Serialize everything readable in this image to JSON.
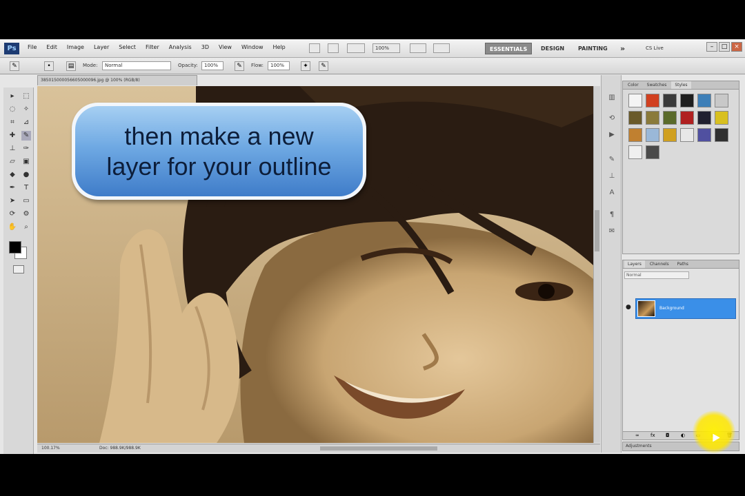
{
  "menubar": {
    "logo": "Ps",
    "items": [
      "File",
      "Edit",
      "Image",
      "Layer",
      "Select",
      "Filter",
      "Analysis",
      "3D",
      "View",
      "Window",
      "Help"
    ],
    "zoom": "100%",
    "workspaces": [
      "ESSENTIALS",
      "DESIGN",
      "PAINTING"
    ],
    "more": "»",
    "cs_live": "CS Live"
  },
  "options": {
    "mode_label": "Mode:",
    "mode_value": "Normal",
    "opacity_label": "Opacity:",
    "opacity_value": "100%",
    "flow_label": "Flow:",
    "flow_value": "100%"
  },
  "document": {
    "tab_title": "385015000056605000096.jpg @ 100% (RGB/8)",
    "zoom_status": "100.17%",
    "doc_info": "Doc: 988.9K/988.9K"
  },
  "callout": {
    "line1": "then make a new",
    "line2": "layer for your outline"
  },
  "styles_panel": {
    "tabs": [
      "Color",
      "Swatches",
      "Styles"
    ],
    "swatch_colors": [
      "#f4f4f4",
      "#d14020",
      "#3a3a3a",
      "#1e1e1e",
      "#3d7fb8",
      "#c8c8c8",
      "#6a5a2a",
      "#8a7a3a",
      "#5a6a2a",
      "#b02020",
      "#202030",
      "#d8c020",
      "#c08030",
      "#9ab8d8",
      "#d0a020",
      "#e8e8e8",
      "#5050a0",
      "#303030",
      "#efefef",
      "#4a4a4a"
    ]
  },
  "layers_panel": {
    "tabs": [
      "Layers",
      "Channels",
      "Paths"
    ],
    "blend_mode": "Normal",
    "layer_name": "Background"
  },
  "adjustments_tab": "Adjustments"
}
